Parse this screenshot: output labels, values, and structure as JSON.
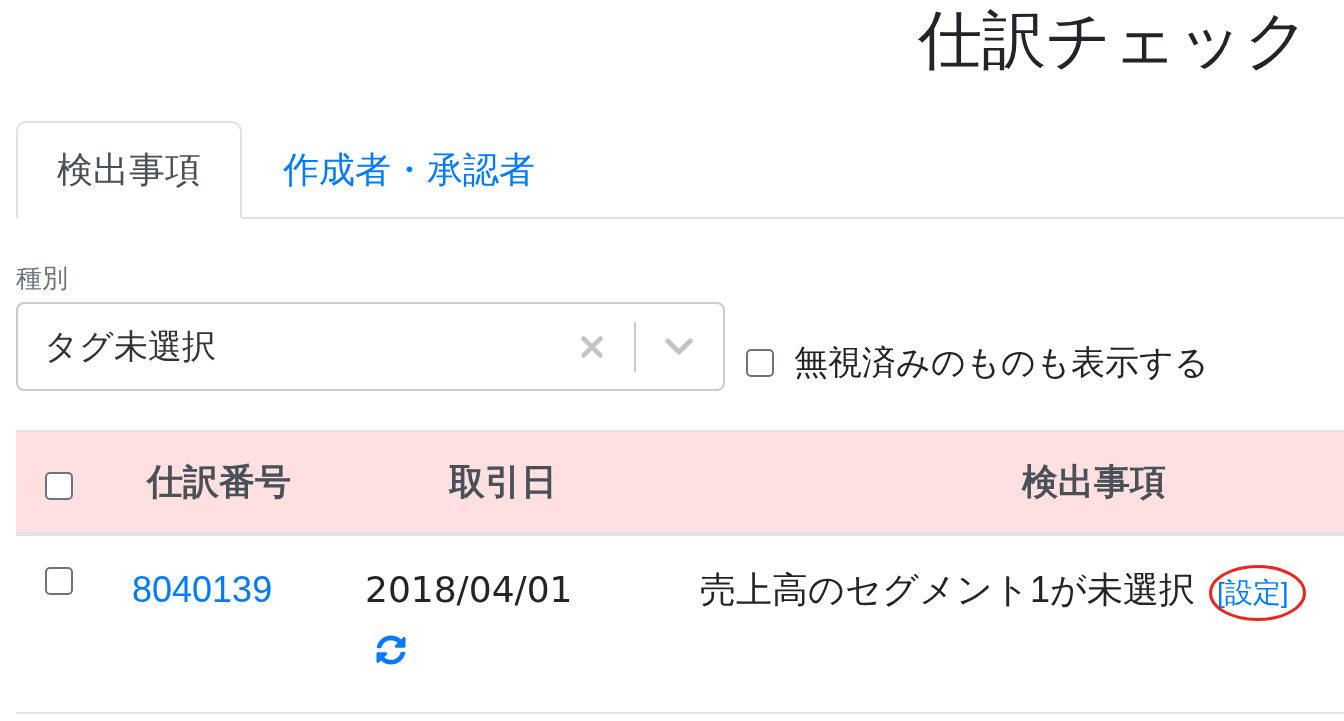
{
  "page": {
    "title": "仕訳チェック"
  },
  "tabs": [
    {
      "label": "検出事項",
      "selected": true
    },
    {
      "label": "作成者・承認者",
      "selected": false
    }
  ],
  "filters": {
    "type_label": "種別",
    "type_select": {
      "value": "タグ未選択"
    },
    "show_ignored": {
      "label": "無視済みのものも表示する",
      "checked": false
    }
  },
  "table": {
    "select_all": {
      "checked": false
    },
    "columns": [
      "仕訳番号",
      "取引日",
      "検出事項"
    ],
    "rows": [
      {
        "checked": false,
        "entry_number": "8040139",
        "date": "2018/04/01",
        "issue": "売上高のセグメント1が未選択",
        "action": {
          "label": "[設定]",
          "circled": true
        }
      }
    ]
  }
}
